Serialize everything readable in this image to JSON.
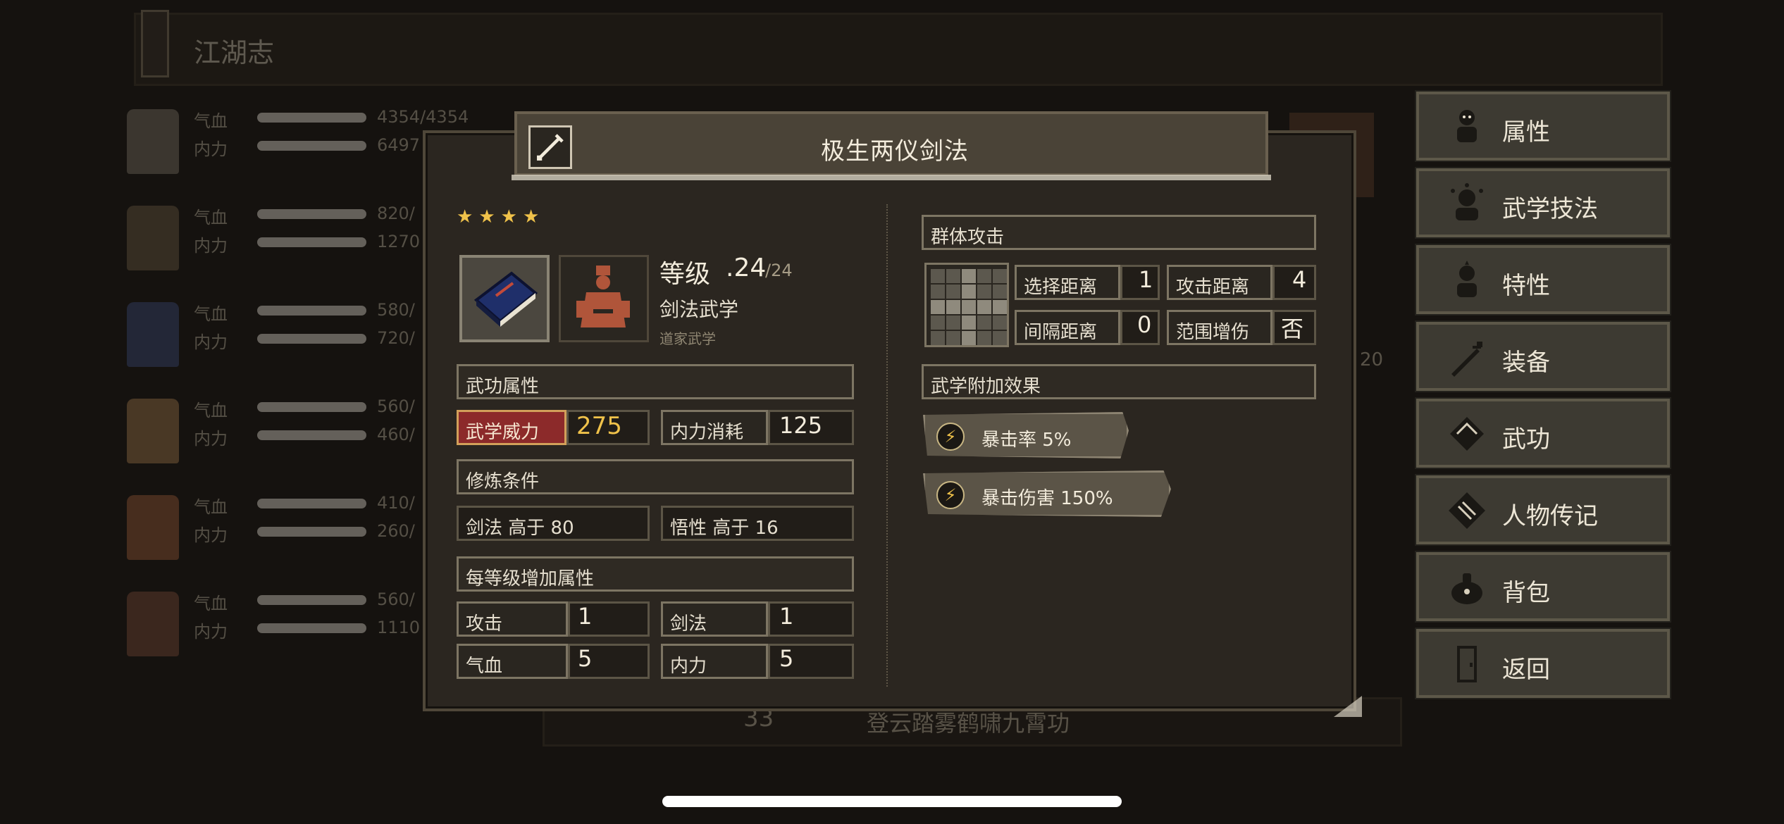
{
  "background": {
    "top_title": "江湖志",
    "roster": [
      {
        "hp_label": "气血",
        "hp_value": "4354/4354",
        "mp_label": "内力",
        "mp_value": "6497"
      },
      {
        "hp_label": "气血",
        "hp_value": "820/",
        "mp_label": "内力",
        "mp_value": "1270"
      },
      {
        "hp_label": "气血",
        "hp_value": "580/",
        "mp_label": "内力",
        "mp_value": "720/"
      },
      {
        "hp_label": "气血",
        "hp_value": "560/",
        "mp_label": "内力",
        "mp_value": "460/"
      },
      {
        "hp_label": "气血",
        "hp_value": "410/",
        "mp_label": "内力",
        "mp_value": "260/"
      },
      {
        "hp_label": "气血",
        "hp_value": "560/",
        "mp_label": "内力",
        "mp_value": "1110"
      }
    ],
    "bottom_number": "33",
    "bottom_text": "登云踏雾鹤啸九霄功",
    "side_number": "20"
  },
  "menu": {
    "items": [
      {
        "label": "属性",
        "icon": "attribute-icon"
      },
      {
        "label": "武学技法",
        "icon": "martial-tech-icon"
      },
      {
        "label": "特性",
        "icon": "trait-icon"
      },
      {
        "label": "装备",
        "icon": "equipment-icon"
      },
      {
        "label": "武功",
        "icon": "kungfu-book-icon"
      },
      {
        "label": "人物传记",
        "icon": "biography-icon"
      },
      {
        "label": "背包",
        "icon": "backpack-icon"
      },
      {
        "label": "返回",
        "icon": "return-door-icon"
      }
    ]
  },
  "skill": {
    "title": "极生两仪剑法",
    "stars": 4,
    "level_label": "等级",
    "level_value": ".24",
    "level_max": "/24",
    "type": "剑法武学",
    "school": "道家武学",
    "section_attr": "武功属性",
    "power_label": "武学威力",
    "power_value": "275",
    "mp_cost_label": "内力消耗",
    "mp_cost_value": "125",
    "section_req": "修炼条件",
    "req_1": "剑法 高于 80",
    "req_2": "悟性 高于 16",
    "section_growth": "每等级增加属性",
    "growth": [
      {
        "label": "攻击",
        "value": "1"
      },
      {
        "label": "剑法",
        "value": "1"
      },
      {
        "label": "气血",
        "value": "5"
      },
      {
        "label": "内力",
        "value": "5"
      }
    ],
    "area_title": "群体攻击",
    "select_range_label": "选择距离",
    "select_range_value": "1",
    "attack_range_label": "攻击距离",
    "attack_range_value": "4",
    "interval_label": "间隔距离",
    "interval_value": "0",
    "area_bonus_label": "范围增伤",
    "area_bonus_value": "否",
    "effects_title": "武学附加效果",
    "effects": [
      {
        "text": "暴击率 5%"
      },
      {
        "text": "暴击伤害 150%"
      }
    ]
  },
  "colors": {
    "accent_gold": "#f0c24a",
    "power_red": "#8c2a2a",
    "panel": "#2b2620"
  }
}
